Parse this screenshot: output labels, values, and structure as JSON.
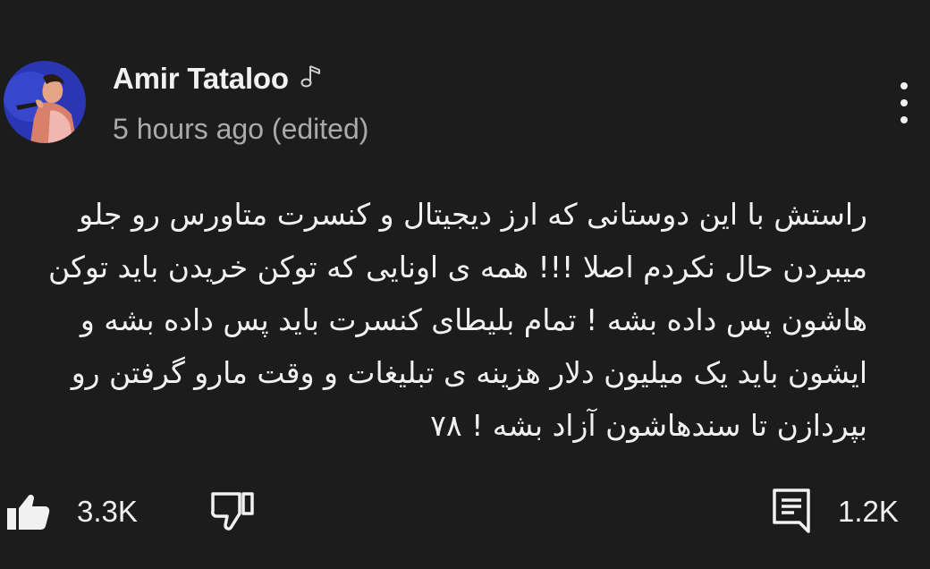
{
  "comment": {
    "author": "Amir Tataloo",
    "author_badge_icon": "music-note-icon",
    "timestamp": "5 hours ago (edited)",
    "lines": [
      "راستش با این دوستانی که ارز دیجیتال و کنسرت متاورس رو جلو",
      "میبردن حال نکردم اصلا !!! همه ی اونایی که توکن خریدن باید توکن",
      "هاشون پس داده بشه ! تمام بلیطای کنسرت باید پس داده بشه و",
      "ایشون باید یک میلیون دلار هزینه ی تبلیغات و وقت مارو گرفتن رو",
      "بپردازن تا سندهاشون آزاد بشه ! ۷۸"
    ]
  },
  "actions": {
    "like_icon": "thumbs-up-icon",
    "like_count": "3.3K",
    "dislike_icon": "thumbs-down-icon",
    "reply_icon": "comment-icon",
    "reply_count": "1.2K",
    "more_icon": "more-vert-icon"
  },
  "colors": {
    "background": "#1c1c1c",
    "primary_text": "#f1f1f1",
    "secondary_text": "#aaaaaa"
  }
}
